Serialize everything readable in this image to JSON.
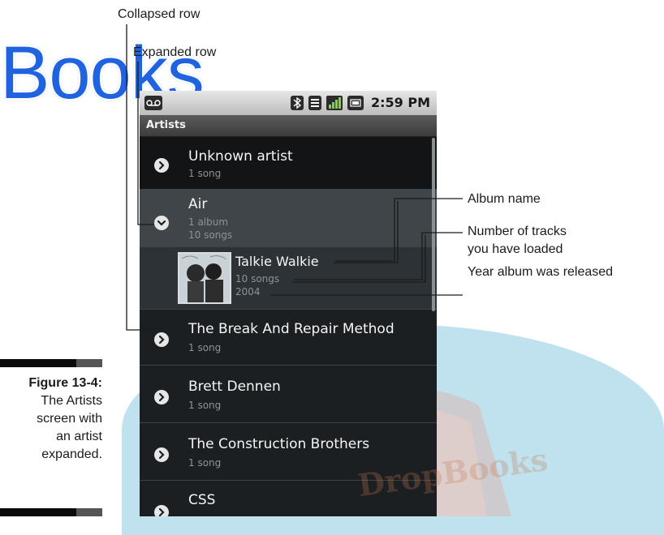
{
  "watermark": {
    "text": "Books",
    "stamp": "DropBooks"
  },
  "callouts": {
    "collapsed_row": "Collapsed row",
    "expanded_row": "Expanded row",
    "album_name": "Album name",
    "tracks_line1": "Number of tracks",
    "tracks_line2": "you have loaded",
    "year": "Year album was released"
  },
  "figure": {
    "number": "Figure 13-4:",
    "line1": "The Artists",
    "line2": "screen with",
    "line3": "an artist",
    "line4": "expanded."
  },
  "status_bar": {
    "time": "2:59 PM",
    "icons": [
      "voicemail-icon",
      "bluetooth-icon",
      "wifi-icon",
      "signal-icon",
      "battery-icon"
    ]
  },
  "screen": {
    "title": "Artists",
    "rows": [
      {
        "title": "Unknown artist",
        "sub": "1 song",
        "state": "collapsed"
      },
      {
        "title": "Air",
        "sub1": "1 album",
        "sub2": "10 songs",
        "state": "expanded"
      },
      {
        "album": "Talkie Walkie",
        "songs": "10 songs",
        "year": "2004"
      },
      {
        "title": "The Break And Repair Method",
        "sub": "1 song",
        "state": "collapsed"
      },
      {
        "title": "Brett Dennen",
        "sub": "1 song",
        "state": "collapsed"
      },
      {
        "title": "The Construction Brothers",
        "sub": "1 song",
        "state": "collapsed"
      },
      {
        "title": "CSS",
        "sub": "",
        "state": "collapsed"
      }
    ]
  },
  "colors": {
    "accent": "#1f63e0",
    "screen_bg": "#1b1f22",
    "row_expanded": "#3f4548"
  }
}
